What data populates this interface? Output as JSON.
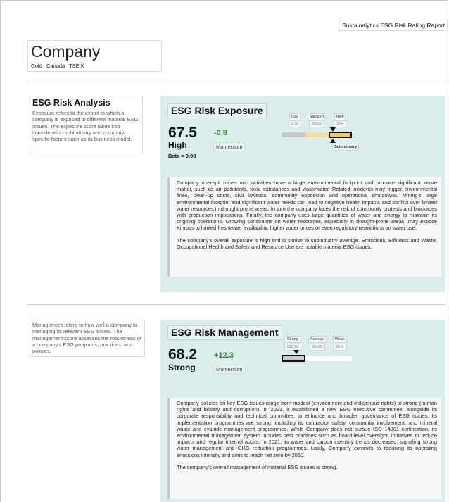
{
  "header": {
    "report_title": "Sustainalytics ESG Risk Rating Report",
    "company_name": "Company",
    "industry": "Gold",
    "country": "Canada",
    "ticker": "TSE:K"
  },
  "exposure_section": {
    "side_title": "ESG Risk Analysis",
    "side_text": "Exposure refers to the extent to which a company is exposed to different material ESG Issues. The exposure score takes into consideration subindustry and company-specific factors such as its business model.",
    "panel_title": "ESG Risk Exposure",
    "score": "67.5",
    "level": "High",
    "beta": "Beta = 0.98",
    "momentum_value": "-0.8",
    "momentum_label": "Momentum",
    "scale": [
      {
        "label": "Low",
        "range": "0-35",
        "color": "#c9c9c9"
      },
      {
        "label": "Medium",
        "range": "35-55",
        "color": "#f2dfa6"
      },
      {
        "label": "High",
        "range": "55+",
        "color": "#f2c85b"
      }
    ],
    "company_marker_level": "High",
    "subindustry_label": "Subindustry",
    "paragraphs": [
      "Company open-pit mines and activities have a large environmental footprint and produce significant waste matter, such as air pollutants, toxic substances and wastewater. Related incidents may trigger environmental fines, clean-up costs, civil lawsuits, community opposition and operational shutdowns. Mining's large environmental footprint and significant water needs can lead to negative health impacts and conflict over limited water resources in drought prone areas. In turn the company faces the risk of community protests and blockades with production implications. Finally, the company uses large quantities of water and energy to maintain its ongoing operations. Growing constraints on water resources, especially in drought-prone areas, may expose Kinross to limited freshwater availability, higher water prices or even regulatory restrictions on water use.",
      "The company's overall exposure is high and is similar to subindustry average. Emissions, Effluents and Waste, Occupational Health and Safety and Resource Use are notable material ESG issues."
    ]
  },
  "management_section": {
    "side_text": "Management refers to how well a company is managing its relevant ESG issues. The management score assesses the robustness of a company's ESG programs, practices, and policies.",
    "panel_title": "ESG Risk Management",
    "score": "68.2",
    "level": "Strong",
    "momentum_value": "+12.3",
    "momentum_label": "Momentum",
    "scale": [
      {
        "label": "Strong",
        "range": "100-50",
        "color": "#c9c9c9"
      },
      {
        "label": "Average",
        "range": "50-25",
        "color": "#ffffff"
      },
      {
        "label": "Weak",
        "range": "25-0",
        "color": "#ffffff"
      }
    ],
    "company_marker_level": "Strong",
    "paragraphs": [
      "Company policies on key ESG issues range from modest (environment and Indigenous rights) to strong (human rights and bribery and corruption). In 2021, it established a new ESG executive committee, alongside its corporate responsibility and technical committee, to enhance and broaden governance of ESG issues. Its implementation programmes are strong, including its contractor safety, community involvement, and mineral waste and cyanide management programmes. While Company does not pursue ISO 14001 certification, its environmental management system includes best practices such as board-level oversight, initiatives to reduce impacts and regular internal audits. In 2021, its water and carbon intensity trends decreased, signaling strong water management and GHG reduction programmes. Lastly, Company commits to reducing its operating emissions intensity and aims to reach net zero by 2050.",
      "The company's overall management of material ESG issues is strong."
    ]
  }
}
